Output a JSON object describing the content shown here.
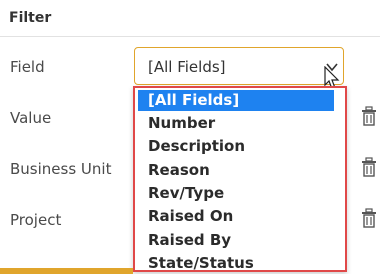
{
  "panel": {
    "title": "Filter"
  },
  "rows": [
    {
      "label": "Field"
    },
    {
      "label": "Value"
    },
    {
      "label": "Business Unit"
    },
    {
      "label": "Project"
    }
  ],
  "field_select": {
    "selected": "[All Fields]"
  },
  "dropdown": {
    "options": [
      "[All Fields]",
      "Number",
      "Description",
      "Reason",
      "Rev/Type",
      "Raised On",
      "Raised By",
      "State/Status"
    ],
    "selected_index": 0
  },
  "colors": {
    "accent": "#e0a52c",
    "highlight": "#1e82f0",
    "dropdown_border": "#e04848"
  }
}
